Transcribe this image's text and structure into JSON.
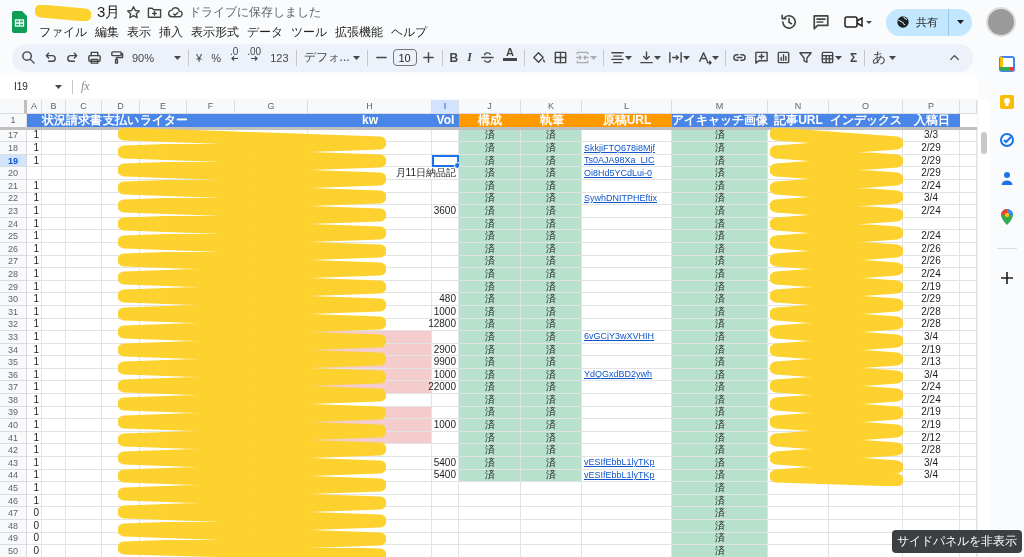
{
  "document": {
    "title": "3月",
    "save_status": "ドライブに保存しました"
  },
  "menu": [
    "ファイル",
    "編集",
    "表示",
    "挿入",
    "表示形式",
    "データ",
    "ツール",
    "拡張機能",
    "ヘルプ"
  ],
  "share": {
    "label": "共有"
  },
  "toolbar": {
    "zoom": "90%",
    "currency": "¥",
    "percent": "%",
    "decrease_decimal": ".0",
    "increase_decimal": ".00",
    "number_format": "123",
    "font": "デフォ...",
    "font_size": "10",
    "bold": "B",
    "italic": "I",
    "text_color": "A",
    "merge_disabled": true,
    "functions": "Σ",
    "input_tools": "あ"
  },
  "formula_bar": {
    "name_box": "I19",
    "fx": "fx"
  },
  "sheet": {
    "header_row_number": "1",
    "columns": [
      {
        "letter": "A",
        "color": "#4a86e8",
        "selected": false
      },
      {
        "letter": "B",
        "header": "状況",
        "color": "#4a86e8",
        "selected": false
      },
      {
        "letter": "C",
        "header": "請求書",
        "color": "#4a86e8",
        "selected": false
      },
      {
        "letter": "D",
        "header": "支払い",
        "color": "#4a86e8",
        "selected": false
      },
      {
        "letter": "E",
        "header": "ライター",
        "color": "#4a86e8",
        "selected": false
      },
      {
        "letter": "F",
        "color": "#4a86e8",
        "selected": false
      },
      {
        "letter": "G",
        "color": "#4a86e8",
        "selected": false
      },
      {
        "letter": "H",
        "header": "kw",
        "color": "#4a86e8",
        "selected": false
      },
      {
        "letter": "I",
        "header": "Vol",
        "color": "#4a86e8",
        "selected": true
      },
      {
        "letter": "J",
        "header": "構成",
        "color": "#ff9900",
        "selected": false
      },
      {
        "letter": "K",
        "header": "執筆",
        "color": "#ff9900",
        "selected": false
      },
      {
        "letter": "L",
        "header": "原稿URL",
        "color": "#ff9900",
        "selected": false
      },
      {
        "letter": "M",
        "header": "アイキャッチ画像",
        "color": "#4a86e8",
        "selected": false
      },
      {
        "letter": "N",
        "header": "記事URL",
        "color": "#4a86e8",
        "selected": false
      },
      {
        "letter": "O",
        "header": "インデックス",
        "color": "#4a86e8",
        "selected": false
      },
      {
        "letter": "P",
        "header": "入稿日",
        "color": "#4a86e8",
        "selected": false
      }
    ],
    "rows": [
      {
        "number": "17",
        "selected": false,
        "a": "1",
        "j": "済",
        "k": "済",
        "m": "済",
        "p": "3/3",
        "kw_highlighted": false
      },
      {
        "number": "18",
        "selected": false,
        "a": "1",
        "j": "済",
        "k": "済",
        "l": "SkkjiFTQ678i8Mjf",
        "m": "済",
        "p": "2/29",
        "kw_highlighted": false
      },
      {
        "number": "19",
        "selected": true,
        "a": "1",
        "j": "済",
        "k": "済",
        "l": "Ts0AJA98Xa_LIC",
        "m": "済",
        "p": "2/29",
        "kw_highlighted": false
      },
      {
        "number": "20",
        "selected": false,
        "kw_tail": "月11日納品記",
        "j": "済",
        "k": "済",
        "l": "Oi8Hd5YCdLui-0",
        "m": "済",
        "p": "2/29",
        "kw_highlighted": false
      },
      {
        "number": "21",
        "selected": false,
        "a": "1",
        "j": "済",
        "k": "済",
        "m": "済",
        "p": "2/24",
        "kw_highlighted": false
      },
      {
        "number": "22",
        "selected": false,
        "a": "1",
        "j": "済",
        "k": "済",
        "l": "SywhDNITPHEftix",
        "m": "済",
        "p": "3/4",
        "kw_highlighted": false
      },
      {
        "number": "23",
        "selected": false,
        "a": "1",
        "vol": "3600",
        "j": "済",
        "k": "済",
        "m": "済",
        "p": "2/24",
        "kw_highlighted": false
      },
      {
        "number": "24",
        "selected": false,
        "a": "1",
        "j": "済",
        "k": "済",
        "m": "済",
        "kw_highlighted": false
      },
      {
        "number": "25",
        "selected": false,
        "a": "1",
        "j": "済",
        "k": "済",
        "m": "済",
        "p": "2/24",
        "kw_highlighted": false
      },
      {
        "number": "26",
        "selected": false,
        "a": "1",
        "j": "済",
        "k": "済",
        "m": "済",
        "p": "2/26",
        "kw_highlighted": false
      },
      {
        "number": "27",
        "selected": false,
        "a": "1",
        "j": "済",
        "k": "済",
        "m": "済",
        "p": "2/26",
        "kw_highlighted": false
      },
      {
        "number": "28",
        "selected": false,
        "a": "1",
        "j": "済",
        "k": "済",
        "m": "済",
        "p": "2/24",
        "kw_highlighted": false
      },
      {
        "number": "29",
        "selected": false,
        "a": "1",
        "j": "済",
        "k": "済",
        "m": "済",
        "p": "2/19",
        "kw_highlighted": false
      },
      {
        "number": "30",
        "selected": false,
        "a": "1",
        "vol": "480",
        "j": "済",
        "k": "済",
        "m": "済",
        "p": "2/29",
        "kw_highlighted": false
      },
      {
        "number": "31",
        "selected": false,
        "a": "1",
        "vol": "1000",
        "j": "済",
        "k": "済",
        "m": "済",
        "p": "2/28",
        "kw_highlighted": false
      },
      {
        "number": "32",
        "selected": false,
        "a": "1",
        "vol": "12800",
        "j": "済",
        "k": "済",
        "m": "済",
        "p": "2/28",
        "kw_highlighted": false
      },
      {
        "number": "33",
        "selected": false,
        "a": "1",
        "j": "済",
        "k": "済",
        "l": "6vGCjY3wXVHIH",
        "m": "済",
        "p": "3/4",
        "kw_highlighted": true
      },
      {
        "number": "34",
        "selected": false,
        "a": "1",
        "vol": "2900",
        "j": "済",
        "k": "済",
        "m": "済",
        "p": "2/19",
        "kw_highlighted": true
      },
      {
        "number": "35",
        "selected": false,
        "a": "1",
        "vol": "9900",
        "j": "済",
        "k": "済",
        "m": "済",
        "p": "2/13",
        "kw_highlighted": true
      },
      {
        "number": "36",
        "selected": false,
        "a": "1",
        "vol": "1000",
        "j": "済",
        "k": "済",
        "l": "YdQGxdBD2ywh",
        "m": "済",
        "p": "3/4",
        "kw_highlighted": true
      },
      {
        "number": "37",
        "selected": false,
        "a": "1",
        "vol": "22000",
        "j": "済",
        "k": "済",
        "m": "済",
        "p": "2/24",
        "kw_highlighted": true
      },
      {
        "number": "38",
        "selected": false,
        "a": "1",
        "j": "済",
        "k": "済",
        "m": "済",
        "p": "2/24",
        "kw_highlighted": false
      },
      {
        "number": "39",
        "selected": false,
        "a": "1",
        "j": "済",
        "k": "済",
        "m": "済",
        "p": "2/19",
        "kw_highlighted": true
      },
      {
        "number": "40",
        "selected": false,
        "a": "1",
        "vol": "1000",
        "j": "済",
        "k": "済",
        "m": "済",
        "p": "2/19",
        "kw_highlighted": true
      },
      {
        "number": "41",
        "selected": false,
        "a": "1",
        "j": "済",
        "k": "済",
        "m": "済",
        "p": "2/12",
        "kw_highlighted": true
      },
      {
        "number": "42",
        "selected": false,
        "a": "1",
        "j": "済",
        "k": "済",
        "m": "済",
        "p": "2/28",
        "kw_highlighted": false
      },
      {
        "number": "43",
        "selected": false,
        "a": "1",
        "vol": "5400",
        "j": "済",
        "k": "済",
        "l": "vESIfEbbL1lyTKp",
        "m": "済",
        "p": "3/4",
        "kw_highlighted": false
      },
      {
        "number": "44",
        "selected": false,
        "a": "1",
        "vol": "5400",
        "j": "済",
        "k": "済",
        "l": "vESIfEbbL1lyTKp",
        "m": "済",
        "p": "3/4",
        "kw_highlighted": false
      },
      {
        "number": "45",
        "selected": false,
        "a": "1",
        "m": "済",
        "kw_highlighted": false
      },
      {
        "number": "46",
        "selected": false,
        "a": "1",
        "m": "済",
        "kw_highlighted": false
      },
      {
        "number": "47",
        "selected": false,
        "a": "0",
        "m": "済",
        "kw_highlighted": false
      },
      {
        "number": "48",
        "selected": false,
        "a": "0",
        "m": "済",
        "kw_highlighted": false
      },
      {
        "number": "49",
        "selected": false,
        "a": "0",
        "m": "済",
        "kw_highlighted": false
      },
      {
        "number": "50",
        "selected": false,
        "a": "0",
        "m": "済",
        "kw_highlighted": false
      }
    ]
  },
  "tooltip": "サイドパネルを非表示"
}
